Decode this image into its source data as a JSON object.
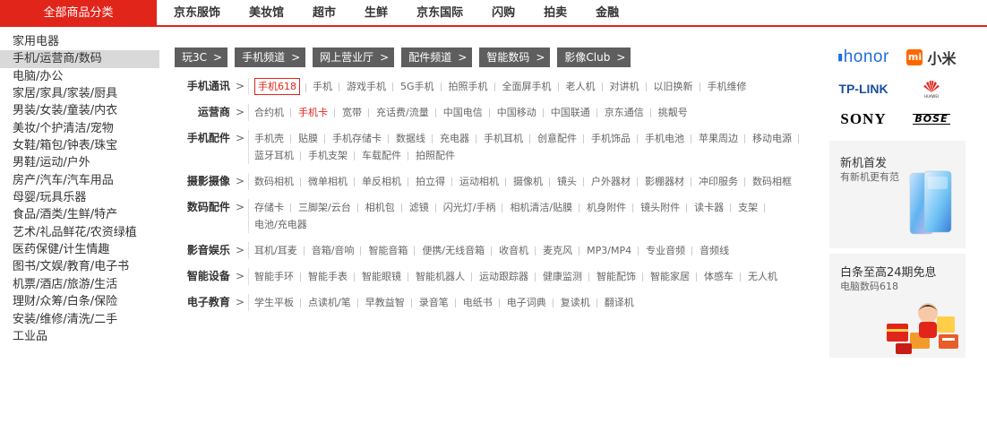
{
  "topnav": {
    "all_categories": "全部商品分类",
    "links": [
      "京东服饰",
      "美妆馆",
      "超市",
      "生鲜",
      "京东国际",
      "闪购",
      "拍卖",
      "金融"
    ]
  },
  "sidebar": {
    "categories": [
      "家用电器",
      "手机/运营商/数码",
      "电脑/办公",
      "家居/家具/家装/厨具",
      "男装/女装/童装/内衣",
      "美妆/个护清洁/宠物",
      "女鞋/箱包/钟表/珠宝",
      "男鞋/运动/户外",
      "房产/汽车/汽车用品",
      "母婴/玩具乐器",
      "食品/酒类/生鲜/特产",
      "艺术/礼品鲜花/农资绿植",
      "医药保健/计生情趣",
      "图书/文娱/教育/电子书",
      "机票/酒店/旅游/生活",
      "理财/众筹/白条/保险",
      "安装/维修/清洗/二手",
      "工业品"
    ],
    "active_index": 1
  },
  "channels": [
    {
      "label": "玩3C",
      "arrow": ">"
    },
    {
      "label": "手机频道",
      "arrow": ">"
    },
    {
      "label": "网上营业厅",
      "arrow": ">"
    },
    {
      "label": "配件频道",
      "arrow": ">"
    },
    {
      "label": "智能数码",
      "arrow": ">"
    },
    {
      "label": "影像Club",
      "arrow": ">"
    }
  ],
  "detail_rows": [
    {
      "title": "手机通讯",
      "gt": ">",
      "items": [
        "手机618",
        "手机",
        "游戏手机",
        "5G手机",
        "拍照手机",
        "全面屏手机",
        "老人机",
        "对讲机",
        "以旧换新",
        "手机维修"
      ]
    },
    {
      "title": "运营商",
      "gt": ">",
      "items": [
        "合约机",
        "手机卡",
        "宽带",
        "充话费/流量",
        "中国电信",
        "中国移动",
        "中国联通",
        "京东通信",
        "挑靓号"
      ]
    },
    {
      "title": "手机配件",
      "gt": ">",
      "items": [
        "手机壳",
        "贴膜",
        "手机存储卡",
        "数据线",
        "充电器",
        "手机耳机",
        "创意配件",
        "手机饰品",
        "手机电池",
        "苹果周边",
        "移动电源",
        "蓝牙耳机",
        "手机支架",
        "车载配件",
        "拍照配件"
      ]
    },
    {
      "title": "摄影摄像",
      "gt": ">",
      "items": [
        "数码相机",
        "微单相机",
        "单反相机",
        "拍立得",
        "运动相机",
        "摄像机",
        "镜头",
        "户外器材",
        "影棚器材",
        "冲印服务",
        "数码相框"
      ]
    },
    {
      "title": "数码配件",
      "gt": ">",
      "items": [
        "存储卡",
        "三脚架/云台",
        "相机包",
        "滤镜",
        "闪光灯/手柄",
        "相机清洁/贴膜",
        "机身附件",
        "镜头附件",
        "读卡器",
        "支架",
        "电池/充电器"
      ]
    },
    {
      "title": "影音娱乐",
      "gt": ">",
      "items": [
        "耳机/耳麦",
        "音箱/音响",
        "智能音箱",
        "便携/无线音箱",
        "收音机",
        "麦克风",
        "MP3/MP4",
        "专业音频",
        "音频线"
      ]
    },
    {
      "title": "智能设备",
      "gt": ">",
      "items": [
        "智能手环",
        "智能手表",
        "智能眼镜",
        "智能机器人",
        "运动跟踪器",
        "健康监测",
        "智能配饰",
        "智能家居",
        "体感车",
        "无人机"
      ]
    },
    {
      "title": "电子教育",
      "gt": ">",
      "items": [
        "学生平板",
        "点读机/笔",
        "早教益智",
        "录音笔",
        "电纸书",
        "电子词典",
        "复读机",
        "翻译机"
      ]
    }
  ],
  "brands": {
    "honor": "honor",
    "xiaomi_mark": "mi",
    "xiaomi": "小米",
    "tplink": "TP-LINK",
    "huawei": "HUAWEI",
    "sony": "SONY",
    "bose": "BOSE"
  },
  "promos": [
    {
      "title": "新机首发",
      "subtitle": "有新机更有范"
    },
    {
      "title": "白条至高24期免息",
      "subtitle": "电脑数码618"
    }
  ],
  "colors": {
    "accent": "#e1251b",
    "channel_bg": "#5e5e5e",
    "promo_bg": "#f4f4f4"
  }
}
